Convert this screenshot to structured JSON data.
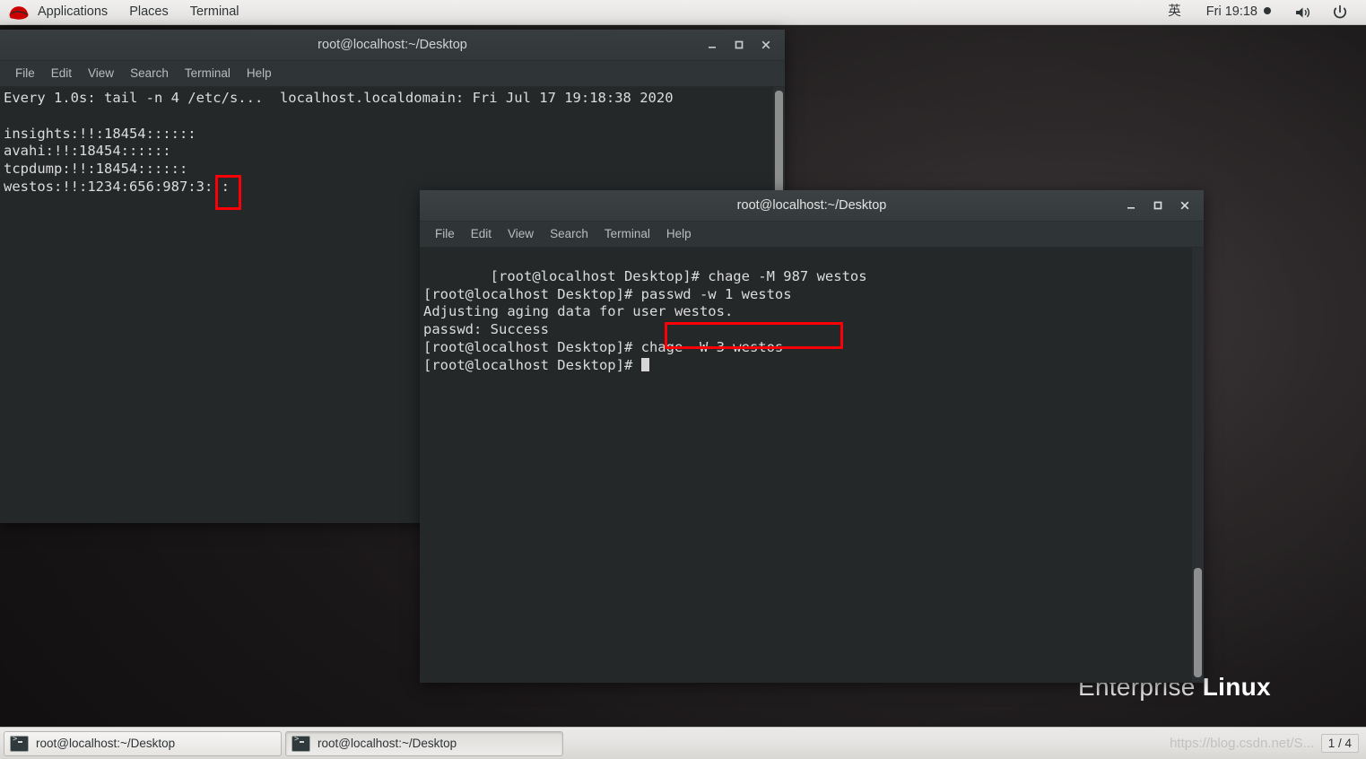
{
  "top_panel": {
    "logo": "redhat-logo",
    "applications": "Applications",
    "places": "Places",
    "terminal": "Terminal",
    "input_method": "英",
    "clock": "Fri 19:18",
    "volume_icon": "volume-icon",
    "power_icon": "power-icon"
  },
  "menubar": {
    "file": "File",
    "edit": "Edit",
    "view": "View",
    "search": "Search",
    "terminal": "Terminal",
    "help": "Help"
  },
  "window_controls": {
    "minimize": "minimize-button",
    "maximize": "maximize-button",
    "close": "close-button"
  },
  "window1": {
    "title": "root@localhost:~/Desktop",
    "content": "Every 1.0s: tail -n 4 /etc/s...  localhost.localdomain: Fri Jul 17 19:18:38 2020\n\ninsights:!!:18454::::::\navahi:!!:18454::::::\ntcpdump:!!:18454::::::\nwestos:!!:1234:656:987:3:::"
  },
  "window2": {
    "title": "root@localhost:~/Desktop",
    "lines": [
      "[root@localhost Desktop]# chage -M 987 westos",
      "[root@localhost Desktop]# passwd -w 1 westos",
      "Adjusting aging data for user westos.",
      "passwd: Success",
      "[root@localhost Desktop]# chage -W 3 westos"
    ],
    "prompt": "[root@localhost Desktop]# "
  },
  "desktop": {
    "brand_thin": "Enterprise",
    "brand_bold": "Linux"
  },
  "taskbar": {
    "task1": "root@localhost:~/Desktop",
    "task2": "root@localhost:~/Desktop",
    "workspace": "1 / 4",
    "watermark": "https://blog.csdn.net/S..."
  },
  "annotations": {
    "highlight1_target": "3",
    "highlight2_target": "chage -W 3 westos",
    "highlight_color": "#fb0007"
  }
}
